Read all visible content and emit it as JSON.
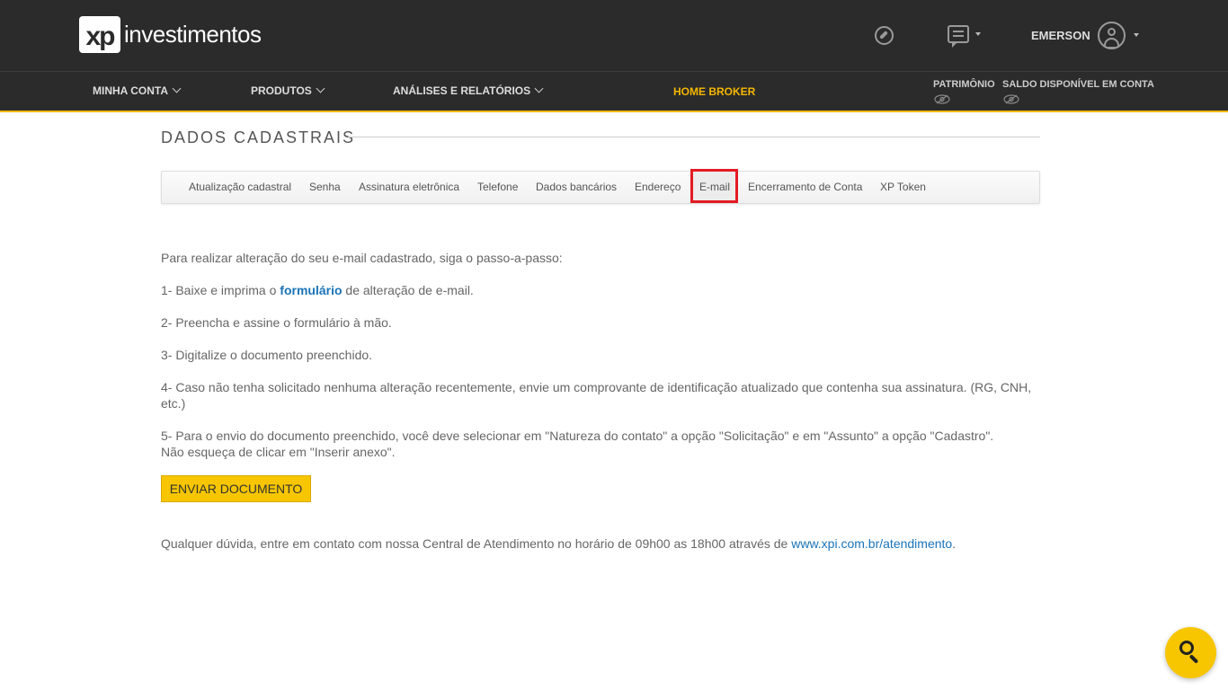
{
  "header": {
    "logo_mark": "xp",
    "logo_text": "investimentos",
    "user_name": "EMERSON"
  },
  "nav": {
    "items": [
      {
        "label": "MINHA CONTA"
      },
      {
        "label": "PRODUTOS"
      },
      {
        "label": "ANÁLISES E RELATÓRIOS"
      },
      {
        "label": "HOME BROKER"
      }
    ],
    "patrimonio_label": "PATRIMÔNIO",
    "saldo_label": "SALDO DISPONÍVEL EM CONTA"
  },
  "section": {
    "title": "DADOS CADASTRAIS"
  },
  "tabs": [
    {
      "label": "Atualização cadastral"
    },
    {
      "label": "Senha"
    },
    {
      "label": "Assinatura eletrônica"
    },
    {
      "label": "Telefone"
    },
    {
      "label": "Dados bancários"
    },
    {
      "label": "Endereço"
    },
    {
      "label": "E-mail"
    },
    {
      "label": "Encerramento de Conta"
    },
    {
      "label": "XP Token"
    }
  ],
  "content": {
    "intro": "Para realizar alteração do seu e-mail cadastrado, siga o passo-a-passo:",
    "step1_pre": "1- Baixe e imprima o ",
    "step1_link": "formulário",
    "step1_post": " de alteração de e-mail.",
    "step2": "2- Preencha e assine o formulário à mão.",
    "step3": "3- Digitalize o documento preenchido.",
    "step4": "4- Caso não tenha solicitado nenhuma alteração recentemente, envie um comprovante de identificação atualizado que contenha sua assinatura. (RG, CNH, etc.)",
    "step5_line1": "5- Para o envio do documento preenchido, você deve selecionar em \"Natureza do contato\" a opção \"Solicitação\" e em \"Assunto\" a opção \"Cadastro\".",
    "step5_line2": "Não esqueça de clicar em \"Inserir anexo\".",
    "button_label": "ENVIAR DOCUMENTO",
    "footer_pre": "Qualquer dúvida, entre em contato com nossa Central de Atendimento no horário de 09h00 as 18h00 através de ",
    "footer_link": "www.xpi.com.br/atendimento",
    "footer_post": "."
  }
}
